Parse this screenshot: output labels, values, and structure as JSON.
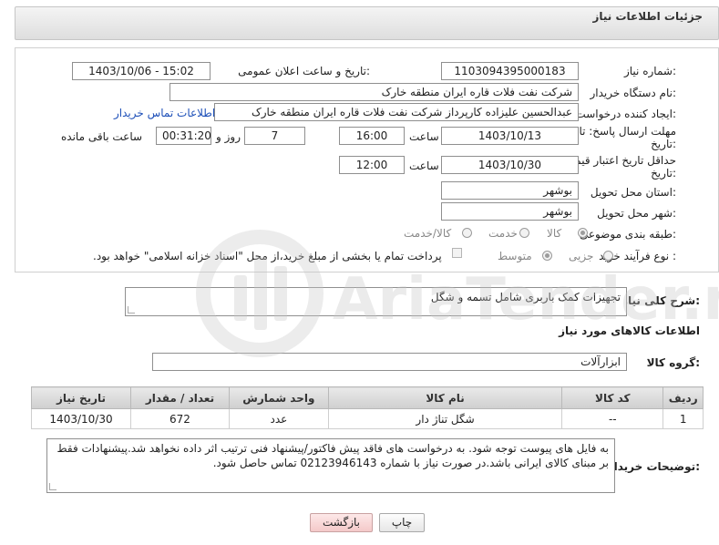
{
  "header": {
    "title": "جزئیات اطلاعات نیاز"
  },
  "form": {
    "need_number_label": "شماره نیاز:",
    "need_number": "1103094395000183",
    "announce_label": "تاریخ و ساعت اعلان عمومی:",
    "announce_value": "1403/10/06 - 15:02",
    "buyer_org_label": "نام دستگاه خریدار:",
    "buyer_org": "شرکت نفت فلات قاره ایران منطقه خارک",
    "creator_label": "ایجاد کننده درخواست:",
    "creator": "عبدالحسین علیزاده کارپرداز شرکت نفت فلات قاره ایران منطقه خارک",
    "contact_link": "اطلاعات تماس خریدار",
    "reply_deadline_label_1": "مهلت ارسال پاسخ: تا",
    "reply_deadline_label_2": "تاریخ:",
    "reply_date": "1403/10/13",
    "time_label": "ساعت",
    "reply_time": "16:00",
    "days_value": "7",
    "days_label": "روز و",
    "remaining_time": "00:31:20",
    "remaining_label": "ساعت باقی مانده",
    "price_deadline_label_1": "حداقل تاریخ اعتبار قیمت: تا",
    "price_deadline_label_2": "تاریخ:",
    "price_date": "1403/10/30",
    "price_time_label": "ساعت",
    "price_time": "12:00",
    "province_label": "استان محل تحویل:",
    "province": "بوشهر",
    "city_label": "شهر محل تحویل:",
    "city": "بوشهر",
    "category_label": "طبقه بندی موضوعی:",
    "category_options": [
      "کالا",
      "خدمت",
      "کالا/خدمت"
    ],
    "process_label": "نوع فرآیند خرید :",
    "process_options": [
      "جزیی",
      "متوسط"
    ],
    "payment_note": "پرداخت تمام یا بخشی از مبلغ خرید،از محل \"اسناد خزانه اسلامی\" خواهد بود."
  },
  "summary": {
    "label": "شرح کلی نیاز:",
    "value": "تجهیزات کمک باربری شامل تسمه و شگل"
  },
  "goods": {
    "section_title": "اطلاعات کالاهای مورد نیاز",
    "group_label": "گروه کالا:",
    "group_value": "ابزارآلات",
    "columns": [
      "ردیف",
      "کد کالا",
      "نام کالا",
      "واحد شمارش",
      "تعداد / مقدار",
      "تاریخ نیاز"
    ],
    "rows": [
      [
        "1",
        "--",
        "شگل تناژ دار",
        "عدد",
        "672",
        "1403/10/30"
      ]
    ]
  },
  "buyer_notes": {
    "label": "توضیحات خریدار:",
    "value": "به فایل های پیوست توجه شود. به درخواست های فاقد پیش فاکتور/پیشنهاد فنی ترتیب اثر داده نخواهد شد.پیشنهادات فقط بر مبنای کالای ایرانی باشد.در صورت نیاز با شماره 02123946143 تماس حاصل شود."
  },
  "buttons": {
    "print": "چاپ",
    "back": "بازگشت"
  },
  "watermark": {
    "text": "AriaTender.net"
  },
  "colors": {
    "link": "#1d4fb8",
    "watermark": "#c8c8c8",
    "back_button": "#f4c9c9"
  }
}
